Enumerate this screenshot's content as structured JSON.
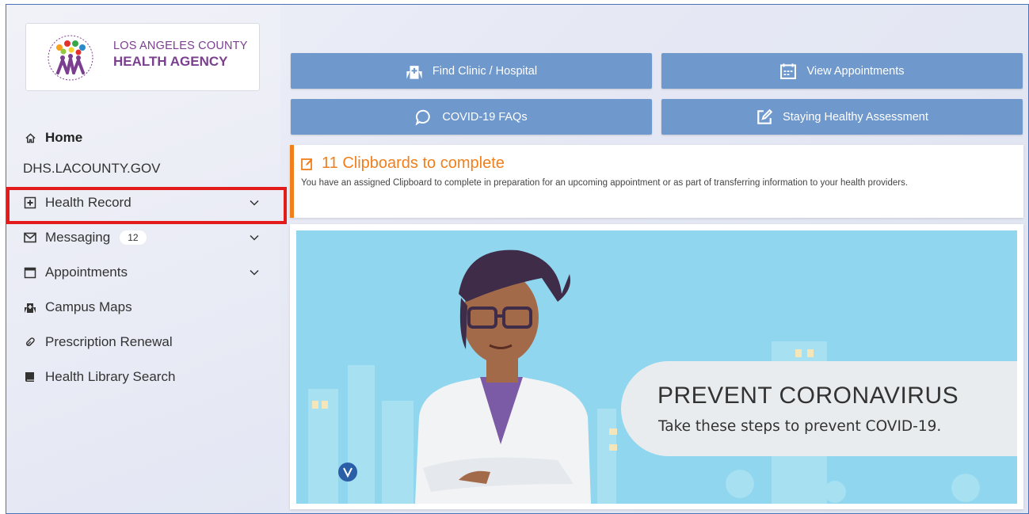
{
  "logo": {
    "line1": "LOS ANGELES COUNTY",
    "line2": "HEALTH AGENCY"
  },
  "nav": {
    "home": "Home",
    "site": "DHS.LACOUNTY.GOV",
    "items": [
      {
        "label": "Health Record",
        "icon": "medical-record-icon",
        "expandable": true
      },
      {
        "label": "Messaging",
        "icon": "envelope-icon",
        "badge": "12",
        "expandable": true
      },
      {
        "label": "Appointments",
        "icon": "calendar-icon",
        "expandable": true
      },
      {
        "label": "Campus Maps",
        "icon": "hospital-building-icon",
        "expandable": false
      },
      {
        "label": "Prescription Renewal",
        "icon": "pill-icon",
        "expandable": false
      },
      {
        "label": "Health Library Search",
        "icon": "book-icon",
        "expandable": false
      }
    ]
  },
  "quick_actions": {
    "find_clinic": "Find Clinic / Hospital",
    "view_appointments": "View Appointments",
    "covid_faqs": "COVID-19 FAQs",
    "staying_healthy": "Staying Healthy Assessment"
  },
  "clipboard": {
    "title": "11 Clipboards to complete",
    "description": "You have an assigned Clipboard to complete in preparation for an upcoming appointment or as part of transferring information to your health providers."
  },
  "banner": {
    "title": "PREVENT CORONAVIRUS",
    "subtitle": "Take these steps to prevent COVID-19."
  },
  "colors": {
    "button": "#6f98cc",
    "accent_orange": "#f07f1c",
    "logo_purple": "#7b3f8f",
    "highlight_red": "#e41b1b"
  }
}
